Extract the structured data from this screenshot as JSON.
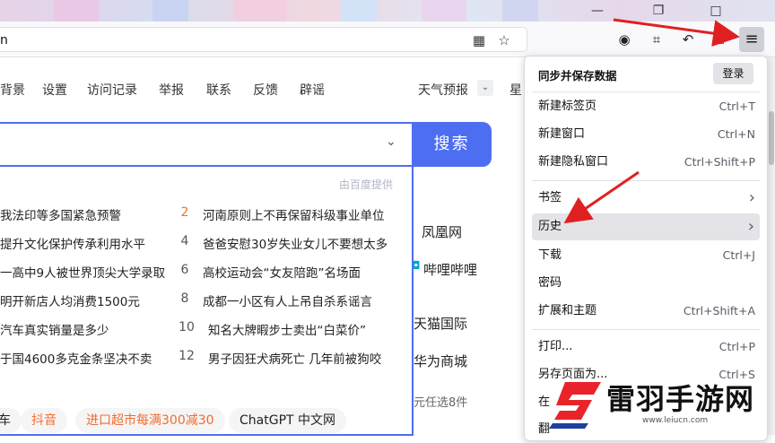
{
  "browser": {
    "url_text": "n",
    "menu_icon": "hamburger-icon"
  },
  "baidu": {
    "nav": [
      "背景",
      "设置",
      "访问记录",
      "举报",
      "联系",
      "反馈",
      "辟谣"
    ],
    "weather": "天气预报",
    "weather_extra": "星",
    "search_button": "搜索",
    "provided_by": "由百度提供",
    "hot_left": [
      "我法印等多国紧急预警",
      "提升文化保护传承利用水平",
      "一高中9人被世界顶尖大学录取",
      "明开新店人均消费1500元",
      "汽车真实销量是多少",
      "于国4600多克金条坚决不卖"
    ],
    "hot_right": [
      {
        "num": "2",
        "text": "河南原则上不再保留科级事业单位"
      },
      {
        "num": "4",
        "text": "爸爸安慰30岁失业女儿不要想太多"
      },
      {
        "num": "6",
        "text": "高校运动会“女友陪跑”名场面"
      },
      {
        "num": "8",
        "text": "成都一小区有人上吊自杀系谣言"
      },
      {
        "num": "10",
        "text": "知名大牌暇步士卖出“白菜价”"
      },
      {
        "num": "12",
        "text": "男子因狂犬病死亡 几年前被狗咬"
      }
    ],
    "side_links": [
      "凤凰网",
      "哔哩哔哩",
      "天猫国际",
      "华为商城",
      "元任选8件"
    ],
    "tags": [
      "车",
      "抖音",
      "进口超市每满300减30",
      "ChatGPT 中文网"
    ]
  },
  "menu": {
    "sync_title": "同步并保存数据",
    "login": "登录",
    "items": [
      {
        "label": "新建标签页",
        "shortcut": "Ctrl+T"
      },
      {
        "label": "新建窗口",
        "shortcut": "Ctrl+N"
      },
      {
        "label": "新建隐私窗口",
        "shortcut": "Ctrl+Shift+P"
      },
      {
        "label": "书签",
        "shortcut": "›"
      },
      {
        "label": "历史",
        "shortcut": "›"
      },
      {
        "label": "下载",
        "shortcut": "Ctrl+J"
      },
      {
        "label": "密码",
        "shortcut": ""
      },
      {
        "label": "扩展和主题",
        "shortcut": "Ctrl+Shift+A"
      },
      {
        "label": "打印...",
        "shortcut": "Ctrl+P"
      },
      {
        "label": "另存页面为...",
        "shortcut": "Ctrl+S"
      },
      {
        "label": "在",
        "shortcut": ""
      },
      {
        "label": "翻",
        "shortcut": ""
      }
    ]
  },
  "watermark": {
    "text": "雷羽手游网",
    "url": "www.leiucn.com"
  },
  "colors": {
    "accent": "#4e6ef2",
    "hot_orange": "#f26d2c",
    "arrow_red": "#e02020"
  }
}
